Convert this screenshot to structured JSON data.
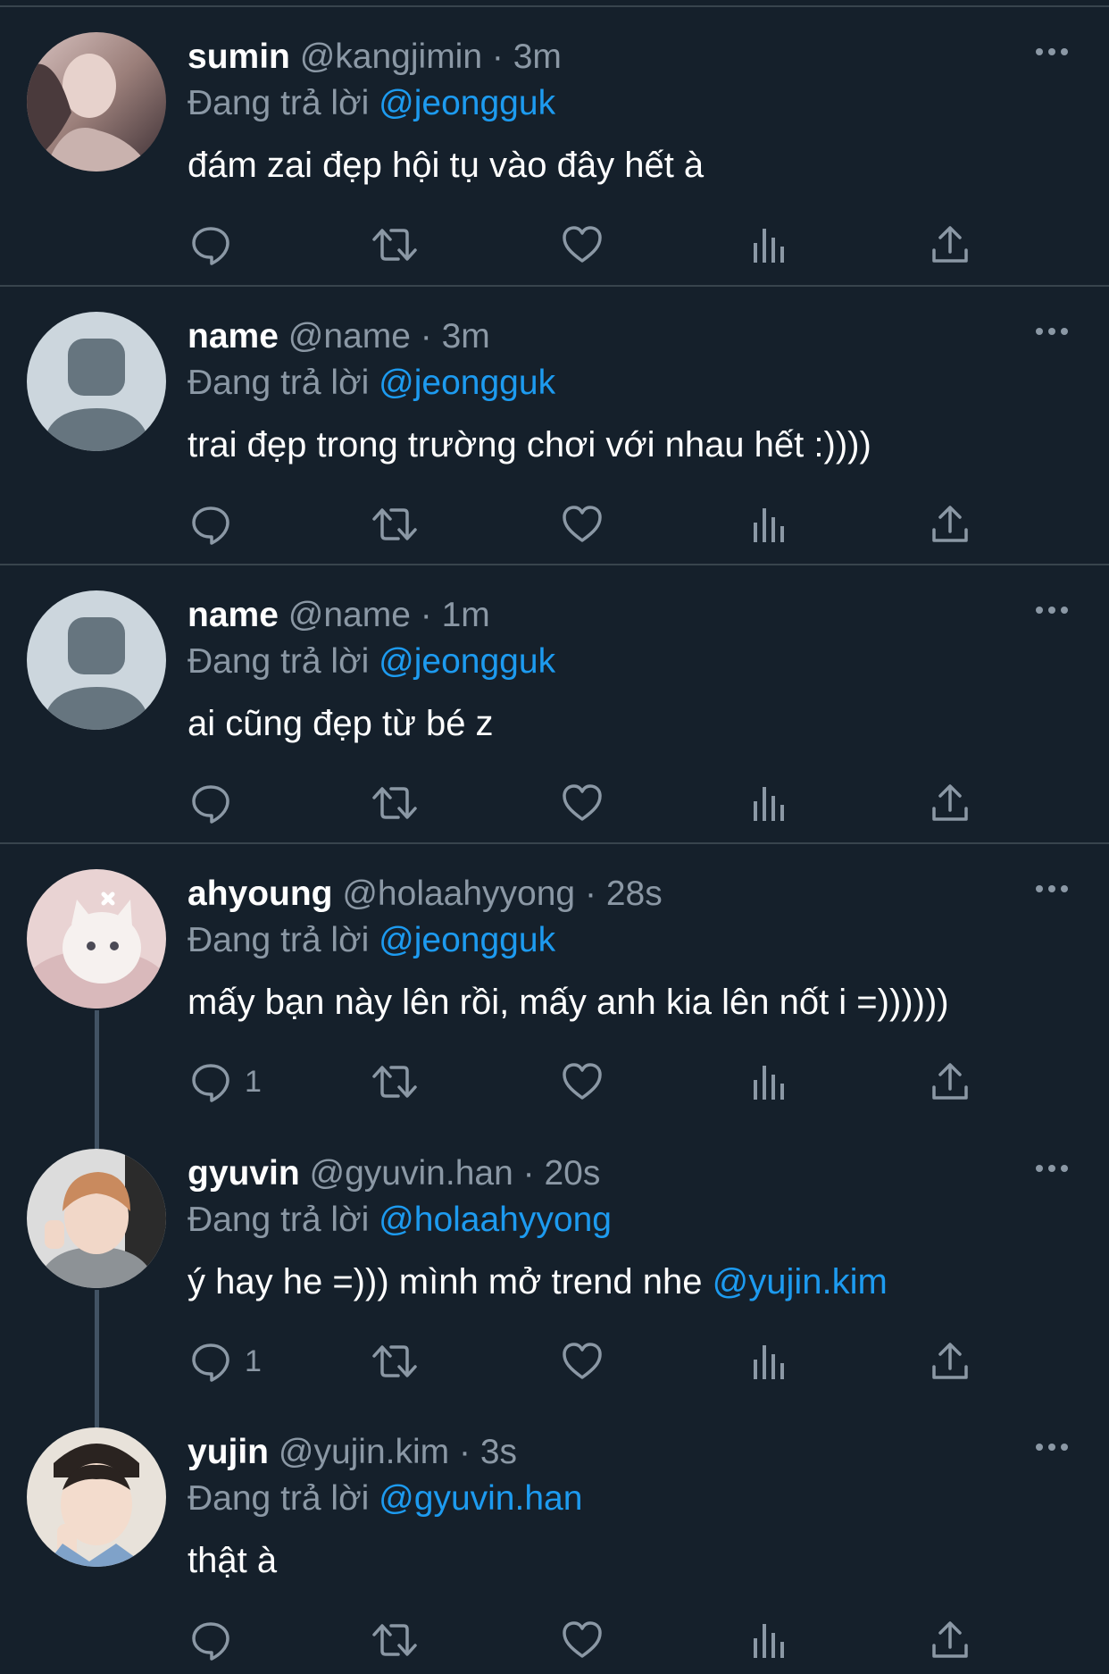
{
  "tweets": [
    {
      "name": "sumin",
      "handle": "@kangjimin",
      "separator": "·",
      "time": "3m",
      "reply_prefix": "Đang trả lời",
      "reply_to": "@jeongguk",
      "text": "đám zai đẹp hội tụ vào đây hết à",
      "text_mention": "",
      "reply_count": "",
      "avatar": "photo-avatar"
    },
    {
      "name": "name",
      "handle": "@name",
      "separator": "·",
      "time": "3m",
      "reply_prefix": "Đang trả lời",
      "reply_to": "@jeongguk",
      "text": "trai đẹp trong trường chơi với nhau hết :))))",
      "text_mention": "",
      "reply_count": "",
      "avatar": "default-avatar"
    },
    {
      "name": "name",
      "handle": "@name",
      "separator": "·",
      "time": "1m",
      "reply_prefix": "Đang trả lời",
      "reply_to": "@jeongguk",
      "text": "ai cũng đẹp từ bé z",
      "text_mention": "",
      "reply_count": "",
      "avatar": "default-avatar"
    },
    {
      "name": "ahyoung",
      "handle": "@holaahyyong",
      "separator": "·",
      "time": "28s",
      "reply_prefix": "Đang trả lời",
      "reply_to": "@jeongguk",
      "text": "mấy bạn này lên rồi, mấy anh kia lên nốt i =))))))",
      "text_mention": "",
      "reply_count": "1",
      "avatar": "kitten-avatar"
    },
    {
      "name": "gyuvin",
      "handle": "@gyuvin.han",
      "separator": "·",
      "time": "20s",
      "reply_prefix": "Đang trả lời",
      "reply_to": "@holaahyyong",
      "text": "ý hay he =))) mình mở trend nhe ",
      "text_mention": "@yujin.kim",
      "reply_count": "1",
      "avatar": "photo-avatar"
    },
    {
      "name": "yujin",
      "handle": "@yujin.kim",
      "separator": "·",
      "time": "3s",
      "reply_prefix": "Đang trả lời",
      "reply_to": "@gyuvin.han",
      "text": "thật à",
      "text_mention": "",
      "reply_count": "",
      "avatar": "photo-avatar"
    }
  ],
  "icons": {
    "reply": "reply-icon",
    "retweet": "retweet-icon",
    "like": "heart-icon",
    "views": "views-icon",
    "share": "share-icon",
    "more": "more-icon"
  },
  "colors": {
    "background": "#15202b",
    "divider": "#38444d",
    "secondary_text": "#8b98a5",
    "link": "#1d9bf0",
    "primary_text": "#ffffff",
    "default_avatar_bg": "#ccd6dd"
  }
}
